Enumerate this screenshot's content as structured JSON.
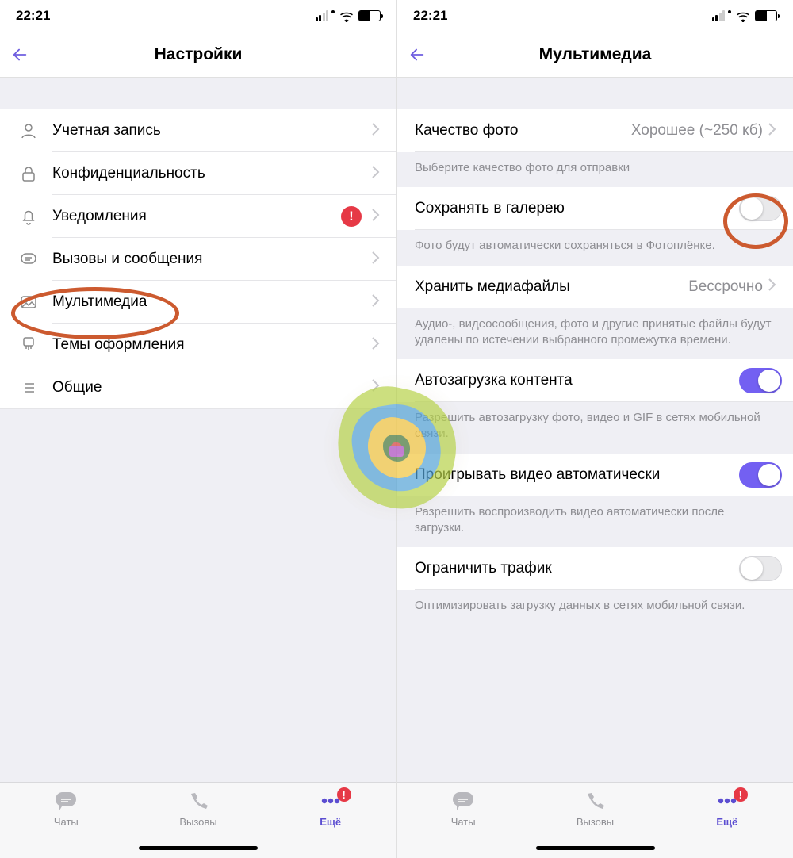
{
  "status": {
    "time": "22:21"
  },
  "left": {
    "title": "Настройки",
    "items": [
      {
        "key": "account",
        "label": "Учетная запись"
      },
      {
        "key": "privacy",
        "label": "Конфиденциальность"
      },
      {
        "key": "notif",
        "label": "Уведомления",
        "alert": "!"
      },
      {
        "key": "calls",
        "label": "Вызовы и сообщения"
      },
      {
        "key": "media",
        "label": "Мультимедиа"
      },
      {
        "key": "themes",
        "label": "Темы оформления"
      },
      {
        "key": "general",
        "label": "Общие"
      }
    ]
  },
  "right": {
    "title": "Мультимедиа",
    "photo_quality": {
      "label": "Качество фото",
      "value": "Хорошее (~250 кб)",
      "note": "Выберите качество фото для отправки"
    },
    "save_gallery": {
      "label": "Сохранять в галерею",
      "on": false,
      "note": "Фото будут автоматически сохраняться в Фотоплёнке."
    },
    "keep_media": {
      "label": "Хранить медиафайлы",
      "value": "Бессрочно",
      "note": "Аудио-, видеосообщения, фото и другие принятые файлы будут удалены по истечении выбранного промежутка времени."
    },
    "autoload": {
      "label": "Автозагрузка контента",
      "on": true,
      "note": "Разрешить автозагрузку фото, видео и GIF в сетях мобильной связи."
    },
    "autoplay": {
      "label": "Проигрывать видео автоматически",
      "on": true,
      "note": "Разрешить воспроизводить видео автоматически после загрузки."
    },
    "limit": {
      "label": "Ограничить трафик",
      "on": false,
      "note": "Оптимизировать загрузку данных в сетях мобильной связи."
    }
  },
  "tabs": {
    "chats": "Чаты",
    "calls": "Вызовы",
    "more": "Ещё",
    "badge": "!"
  }
}
